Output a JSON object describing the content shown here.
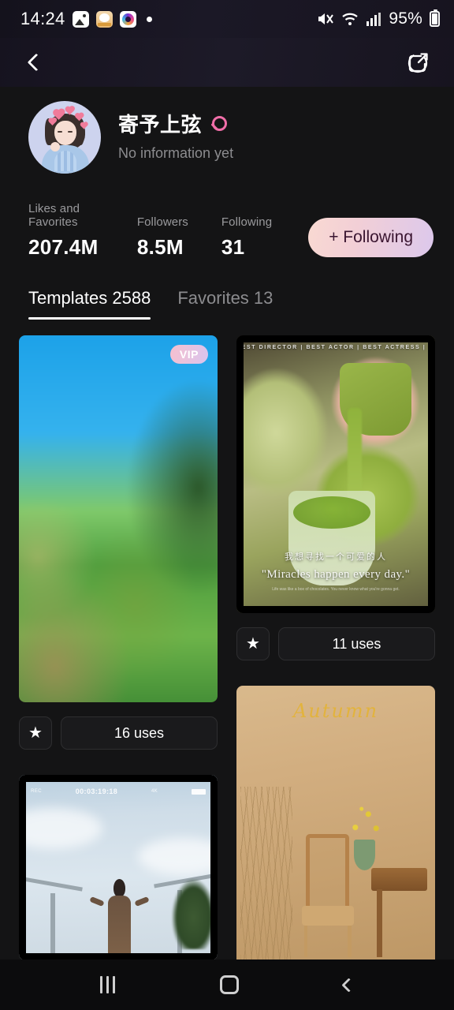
{
  "status_bar": {
    "time": "14:24",
    "battery_percent": "95%",
    "app_icons": [
      "gallery-icon",
      "cat-app-icon",
      "camera-app-icon"
    ],
    "right_icons": [
      "mute-icon",
      "wifi-icon",
      "signal-icon",
      "battery-icon"
    ]
  },
  "header": {
    "back_icon": "back-chevron-icon",
    "share_icon": "share-icon"
  },
  "profile": {
    "avatar": "user-avatar-illustration",
    "name": "寄予上弦",
    "gender_icon": "female-gender-icon",
    "bio": "No information yet"
  },
  "stats": [
    {
      "label": "Likes and Favorites",
      "value": "207.4M"
    },
    {
      "label": "Followers",
      "value": "8.5M"
    },
    {
      "label": "Following",
      "value": "31"
    }
  ],
  "follow_button": {
    "label": "+ Following",
    "gradient_start": "#f9d9d2",
    "gradient_end": "#dcc8ec",
    "text_color": "#3a1530"
  },
  "tabs": [
    {
      "label": "Templates 2588",
      "active": true
    },
    {
      "label": "Favorites 13",
      "active": false
    }
  ],
  "templates": {
    "left_column": [
      {
        "art": "blurred-garden-landscape",
        "badge": "VIP",
        "favorite_icon": "star-icon",
        "uses": "16 uses"
      },
      {
        "art": "sky-viewfinder-video",
        "timecode": "00:03:19:18",
        "viewfinder_left": "REC",
        "viewfinder_right": "4K"
      }
    ],
    "right_column": [
      {
        "art": "matcha-pour-poster",
        "top_banner": "BEST DIRECTOR  |  BEST ACTOR  |  BEST ACTRESS  |  BEST ART DIRECTION",
        "overlay_cn": "我想寻找一个可爱的人",
        "overlay_en": "\"Miracles happen every day.\"",
        "overlay_small": "Life was like a box of chocolates. You never know what you're gonna get.",
        "favorite_icon": "star-icon",
        "uses": "11 uses"
      },
      {
        "art": "autumn-chair-poster",
        "title": "Autumn"
      }
    ]
  },
  "nav_bar": {
    "recents_icon": "recents-icon",
    "home_icon": "home-icon",
    "back_icon": "back-icon"
  },
  "theme": {
    "background": "#141415",
    "card_surface": "#1a1a1c",
    "accent_pink": "#f06ea8"
  }
}
